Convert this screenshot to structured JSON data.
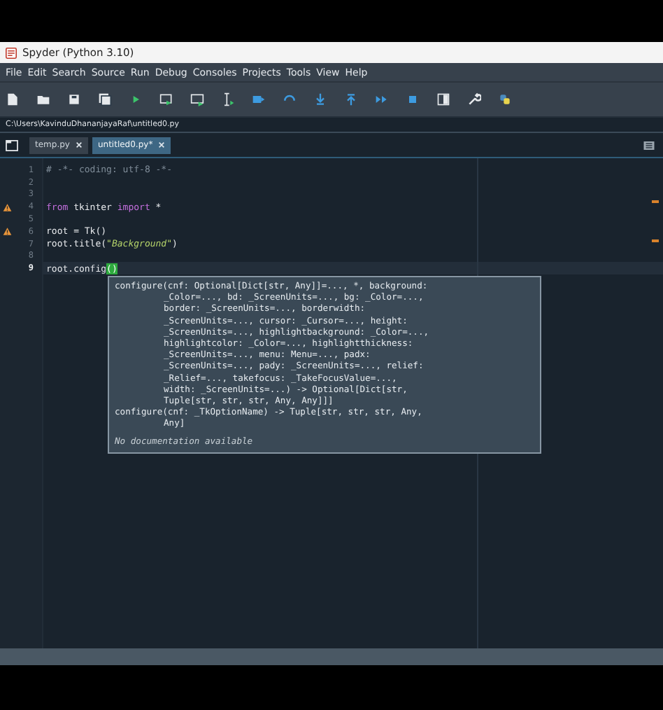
{
  "window": {
    "title": "Spyder (Python 3.10)"
  },
  "menu": [
    "File",
    "Edit",
    "Search",
    "Source",
    "Run",
    "Debug",
    "Consoles",
    "Projects",
    "Tools",
    "View",
    "Help"
  ],
  "path": "C:\\Users\\KavinduDhananjayaRaf\\untitled0.py",
  "tabs": [
    {
      "label": "temp.py",
      "selected": false
    },
    {
      "label": "untitled0.py*",
      "selected": true
    }
  ],
  "editor": {
    "lines": [
      {
        "number": "1",
        "warning": false,
        "current": false,
        "tokens": [
          {
            "kind": "comment",
            "text": "# -*- coding: utf-8 -*-"
          }
        ]
      },
      {
        "number": "2",
        "warning": false,
        "current": false
      },
      {
        "number": "3",
        "warning": false,
        "current": false
      },
      {
        "number": "4",
        "warning": true,
        "current": false,
        "tokens": [
          {
            "kind": "keyword",
            "text": "from"
          },
          {
            "kind": "plain",
            "text": " tkinter "
          },
          {
            "kind": "keyword",
            "text": "import"
          },
          {
            "kind": "plain",
            "text": " *"
          }
        ]
      },
      {
        "number": "5",
        "warning": false,
        "current": false
      },
      {
        "number": "6",
        "warning": true,
        "current": false,
        "tokens": [
          {
            "kind": "plain",
            "text": "root = Tk()"
          }
        ]
      },
      {
        "number": "7",
        "warning": false,
        "current": false,
        "tokens": [
          {
            "kind": "plain",
            "text": "root.title("
          },
          {
            "kind": "string",
            "text": "\"Background\""
          },
          {
            "kind": "plain",
            "text": ")"
          }
        ]
      },
      {
        "number": "8",
        "warning": false,
        "current": false
      },
      {
        "number": "9",
        "warning": false,
        "current": true,
        "tokens": [
          {
            "kind": "plain",
            "text": "root.config"
          },
          {
            "kind": "match",
            "text": "()"
          }
        ]
      }
    ],
    "tooltip": [
      {
        "kind": "signature",
        "text": "configure(cnf: Optional[Dict[str, Any]]=..., *, background:"
      },
      {
        "kind": "continuation",
        "text": "_Color=..., bd: _ScreenUnits=..., bg: _Color=...,"
      },
      {
        "kind": "continuation",
        "text": "border: _ScreenUnits=..., borderwidth:"
      },
      {
        "kind": "continuation",
        "text": "_ScreenUnits=..., cursor: _Cursor=..., height:"
      },
      {
        "kind": "continuation",
        "text": "_ScreenUnits=..., highlightbackground: _Color=...,"
      },
      {
        "kind": "continuation",
        "text": "highlightcolor: _Color=..., highlightthickness:"
      },
      {
        "kind": "continuation",
        "text": "_ScreenUnits=..., menu: Menu=..., padx:"
      },
      {
        "kind": "continuation",
        "text": "_ScreenUnits=..., pady: _ScreenUnits=..., relief:"
      },
      {
        "kind": "continuation",
        "text": "_Relief=..., takefocus: _TakeFocusValue=...,"
      },
      {
        "kind": "continuation",
        "text": "width: _ScreenUnits=...) -> Optional[Dict[str,"
      },
      {
        "kind": "continuation",
        "text": "Tuple[str, str, str, Any, Any]]]"
      },
      {
        "kind": "signature",
        "text": "configure(cnf: _TkOptionName) -> Tuple[str, str, str, Any,"
      },
      {
        "kind": "continuation",
        "text": "Any]"
      },
      {
        "kind": "doc",
        "text": "No documentation available"
      }
    ]
  }
}
